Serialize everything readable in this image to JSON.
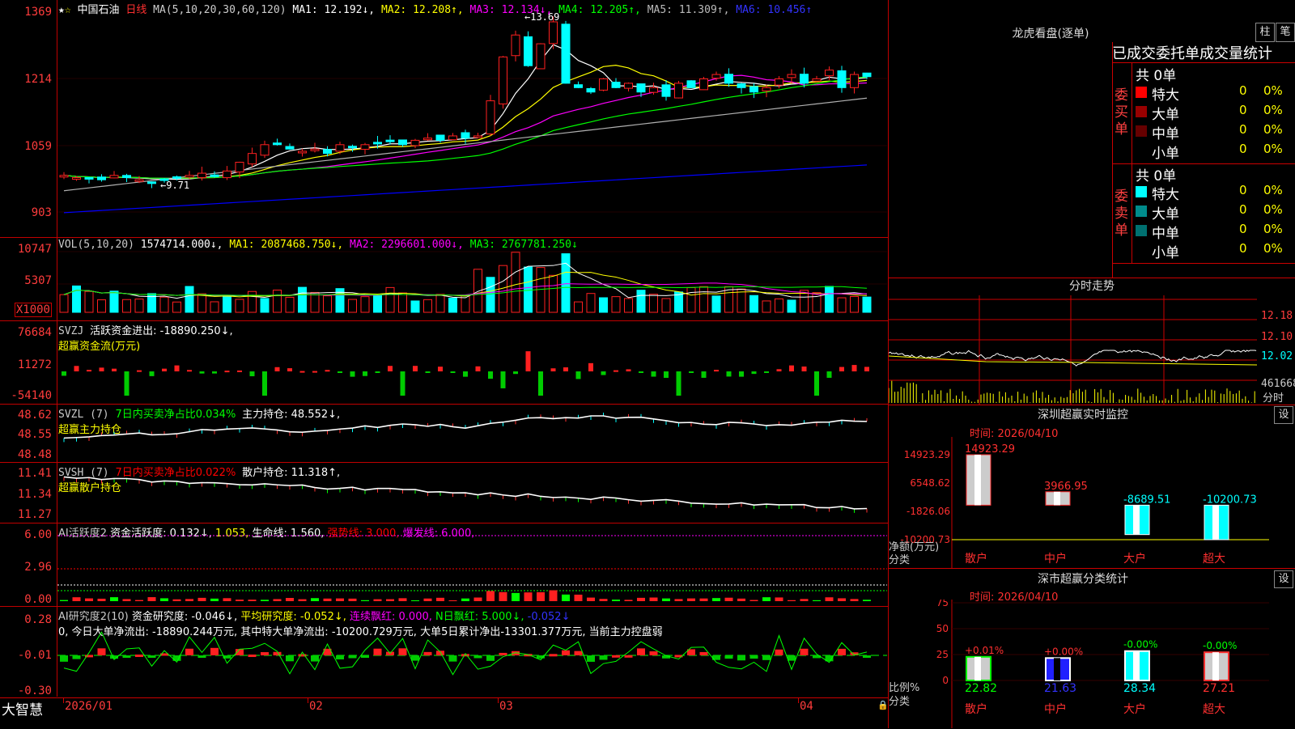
{
  "colors": {
    "up": "#ff2020",
    "down": "#00ffff",
    "ma1": "#ffffff",
    "ma2": "#ffff00",
    "ma3": "#ff00ff",
    "ma4": "#00ff00",
    "ma5": "#b0b0b0",
    "ma6": "#0000ff",
    "grid": "#c00000",
    "green": "#00cc00"
  },
  "main": {
    "star": "★",
    "star2": "☆",
    "stock_name": "中国石油",
    "period": "日线",
    "ma_label": "MA(5,10,20,30,60,120)",
    "ma1": "MA1: 12.192↓,",
    "ma2": "MA2: 12.208↑,",
    "ma3": "MA3: 12.134↓,",
    "ma4": "MA4: 12.205↑,",
    "ma5": "MA5: 11.309↑,",
    "ma6": "MA6: 10.456↑",
    "y_labels": [
      "1369",
      "1214",
      "1059",
      "903"
    ],
    "high_label": "13.69",
    "low_label": "9.71"
  },
  "vol": {
    "title": "VOL(5,10,20)",
    "value": "1574714.000↓,",
    "ma1": "MA1: 2087468.750↓,",
    "ma2": "MA2: 2296601.000↓,",
    "ma3": "MA3: 2767781.250↓",
    "y_labels": [
      "10747",
      "5307"
    ],
    "unit": "X1000"
  },
  "svzj": {
    "title": "SVZJ",
    "label": "活跃资金进出: -18890.250↓,",
    "sub": "超赢资金流(万元)",
    "y_labels": [
      "76684",
      "11272",
      "-54140"
    ]
  },
  "svzl": {
    "title": "SVZL (7)",
    "label1": "7日内买卖净占比0.034%",
    "label2": "主力持仓: 48.552↓,",
    "sub": "超赢主力持仓",
    "y_labels": [
      "48.62",
      "48.55",
      "48.48"
    ]
  },
  "svsh": {
    "title": "SVSH (7)",
    "label1": "7日内买卖净占比0.022%",
    "label2": "散户持仓: 11.318↑,",
    "sub": "超赢散户持仓",
    "y_labels": [
      "11.41",
      "11.34",
      "11.27"
    ]
  },
  "ai1": {
    "title": "AI活跃度2",
    "a": "资金活跃度: 0.132↓,",
    "b": "1.053,",
    "c": "生命线: 1.560,",
    "d": "强势线: 3.000,",
    "e": "爆发线: 6.000,",
    "y_labels": [
      "6.00",
      "2.96",
      "0.00"
    ]
  },
  "ai2": {
    "title": "AI研究度2(10)",
    "a": "资金研究度: -0.046↓,",
    "b": "平均研究度: -0.052↓,",
    "c": "连续飘红: 0.000,",
    "d": "N日飘红: 5.000↓,",
    "e": "-0.052↓",
    "summary": "0, 今日大单净流出: -18890.244万元, 其中特大单净流出: -10200.729万元, 大单5日累计净出-13301.377万元, 当前主力控盘弱",
    "y_labels": [
      "0.28",
      "-0.01",
      "-0.30"
    ]
  },
  "xaxis": {
    "labels": [
      "2026/01",
      "02",
      "03",
      "04"
    ]
  },
  "brand": "大智慧",
  "lhb": {
    "title": "龙虎看盘(逐单)",
    "btn1": "柱",
    "btn2": "笔",
    "tabs": "已成交委托单成交量统计",
    "buy_total": "共 0单",
    "sell_total": "共 0单",
    "buy_side": "委买单",
    "sell_side": "委卖单",
    "rows": [
      {
        "name": "特大",
        "v": "0",
        "p": "0%"
      },
      {
        "name": "大单",
        "v": "0",
        "p": "0%"
      },
      {
        "name": "中单",
        "v": "0",
        "p": "0%"
      },
      {
        "name": "小单",
        "v": "0",
        "p": "0%"
      }
    ]
  },
  "intraday": {
    "title": "分时走势",
    "y_labels": [
      "12.18",
      "12.10",
      "12.02",
      "461668"
    ],
    "fen_shi": "分时"
  },
  "sz_monitor": {
    "title": "深圳超赢实时监控",
    "set": "设",
    "time": "时间: 2026/04/10",
    "y_labels": [
      "14923.29",
      "6548.62",
      "-1826.06",
      "-10200.73"
    ],
    "bars": [
      {
        "cat": "散户",
        "value": 14923.29,
        "label": "14923.29"
      },
      {
        "cat": "中户",
        "value": 3966.95,
        "label": "3966.95"
      },
      {
        "cat": "大户",
        "value": -8689.51,
        "label": "-8689.51"
      },
      {
        "cat": "超大",
        "value": -10200.73,
        "label": "-10200.73"
      }
    ],
    "left1": "净额(万元)",
    "left2": "分类"
  },
  "sz_class": {
    "title": "深市超赢分类统计",
    "set": "设",
    "time": "时间: 2026/04/10",
    "y_labels": [
      "75",
      "50",
      "25",
      "0"
    ],
    "bars": [
      {
        "cat": "散户",
        "pct": 22.82,
        "label": "22.82",
        "chg": "+0.01%"
      },
      {
        "cat": "中户",
        "pct": 21.63,
        "label": "21.63",
        "chg": "+0.00%"
      },
      {
        "cat": "大户",
        "pct": 28.34,
        "label": "28.34",
        "chg": "-0.00%"
      },
      {
        "cat": "超大",
        "pct": 27.21,
        "label": "27.21",
        "chg": "-0.00%"
      }
    ],
    "left1": "比例%",
    "left2": "分类"
  }
}
